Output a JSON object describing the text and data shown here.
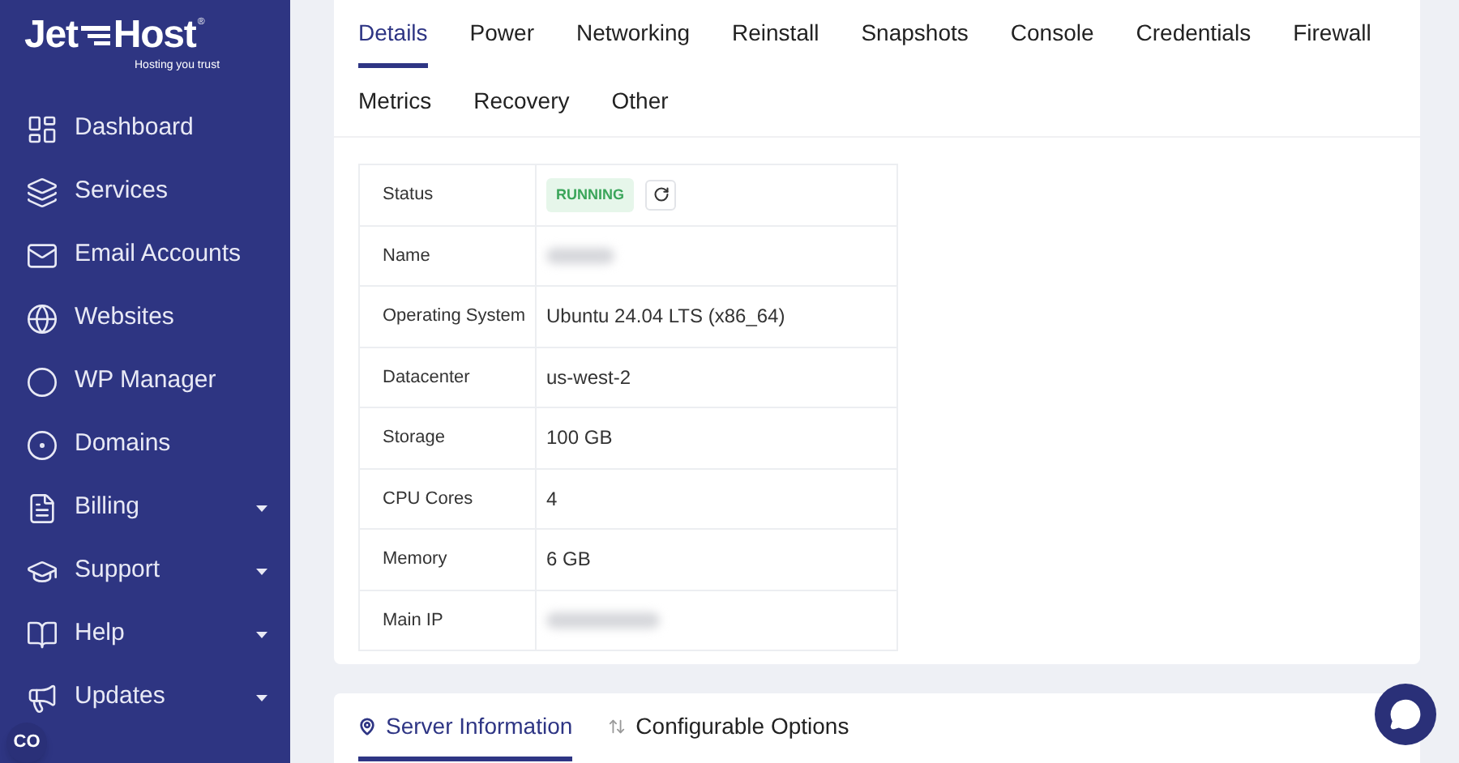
{
  "logo": {
    "left": "Jet",
    "right": "Host",
    "mark": "®",
    "tagline": "Hosting you trust"
  },
  "sidebar": {
    "items": [
      {
        "label": "Dashboard",
        "expandable": false
      },
      {
        "label": "Services",
        "expandable": false
      },
      {
        "label": "Email Accounts",
        "expandable": false
      },
      {
        "label": "Websites",
        "expandable": false
      },
      {
        "label": "WP Manager",
        "expandable": false
      },
      {
        "label": "Domains",
        "expandable": false
      },
      {
        "label": "Billing",
        "expandable": true
      },
      {
        "label": "Support",
        "expandable": true
      },
      {
        "label": "Help",
        "expandable": true
      },
      {
        "label": "Updates",
        "expandable": true
      }
    ]
  },
  "user_badge": {
    "initials": "CO"
  },
  "tabs": [
    {
      "label": "Details",
      "selected": true
    },
    {
      "label": "Power",
      "selected": false
    },
    {
      "label": "Networking",
      "selected": false
    },
    {
      "label": "Reinstall",
      "selected": false
    },
    {
      "label": "Snapshots",
      "selected": false
    },
    {
      "label": "Console",
      "selected": false
    },
    {
      "label": "Credentials",
      "selected": false
    },
    {
      "label": "Firewall",
      "selected": false
    },
    {
      "label": "Metrics",
      "selected": false
    },
    {
      "label": "Recovery",
      "selected": false
    },
    {
      "label": "Other",
      "selected": false
    }
  ],
  "details": [
    {
      "label": "Status",
      "kind": "status",
      "value": "RUNNING"
    },
    {
      "label": "Name",
      "kind": "redacted"
    },
    {
      "label": "Operating System",
      "kind": "text",
      "value": "Ubuntu 24.04 LTS (x86_64)"
    },
    {
      "label": "Datacenter",
      "kind": "text",
      "value": "us-west-2"
    },
    {
      "label": "Storage",
      "kind": "text",
      "value": "100 GB"
    },
    {
      "label": "CPU Cores",
      "kind": "text",
      "value": "4"
    },
    {
      "label": "Memory",
      "kind": "text",
      "value": "6 GB"
    },
    {
      "label": "Main IP",
      "kind": "redacted"
    }
  ],
  "bottom_tabs": [
    {
      "label": "Server Information",
      "selected": true
    },
    {
      "label": "Configurable Options",
      "selected": false
    }
  ]
}
